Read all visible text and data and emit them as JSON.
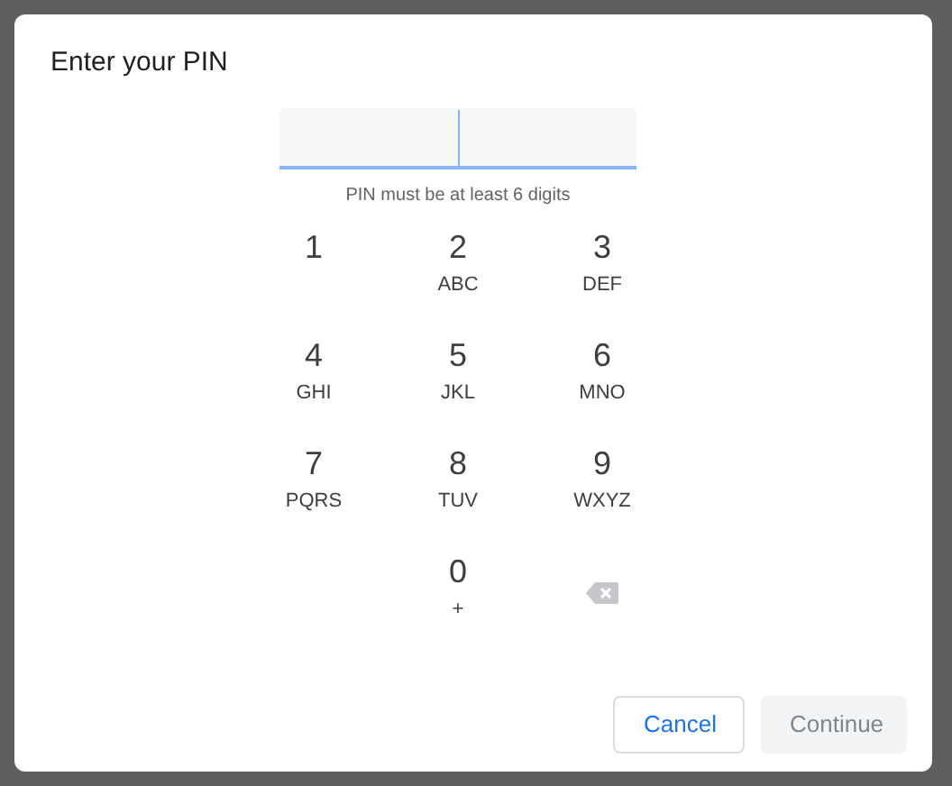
{
  "dialog": {
    "title": "Enter your PIN",
    "pin_field": {
      "focused": true
    },
    "hint": "PIN must be at least 6 digits",
    "keys": [
      {
        "kind": "digit",
        "digit": "1"
      },
      {
        "kind": "digit",
        "digit": "2",
        "letters": "ABC"
      },
      {
        "kind": "digit",
        "digit": "3",
        "letters": "DEF"
      },
      {
        "kind": "digit",
        "digit": "4",
        "letters": "GHI"
      },
      {
        "kind": "digit",
        "digit": "5",
        "letters": "JKL"
      },
      {
        "kind": "digit",
        "digit": "6",
        "letters": "MNO"
      },
      {
        "kind": "digit",
        "digit": "7",
        "letters": "PQRS"
      },
      {
        "kind": "digit",
        "digit": "8",
        "letters": "TUV"
      },
      {
        "kind": "digit",
        "digit": "9",
        "letters": "WXYZ"
      },
      {
        "kind": "blank"
      },
      {
        "kind": "digit",
        "digit": "0",
        "letters": "+"
      },
      {
        "kind": "backspace"
      }
    ],
    "buttons": [
      {
        "label": "Cancel",
        "disabled": false
      },
      {
        "label": "Continue",
        "disabled": true
      }
    ]
  }
}
